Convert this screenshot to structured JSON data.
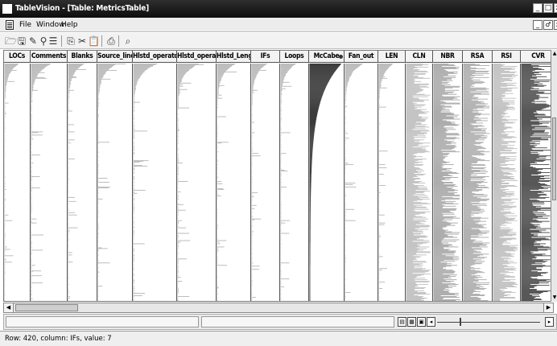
{
  "window": {
    "title": "TableVision - [Table: MetricsTable]",
    "controls": [
      "_",
      "□",
      "x"
    ]
  },
  "menu": {
    "items": [
      "File",
      "Window",
      "Help"
    ],
    "child_controls": [
      "_",
      "♂",
      "x"
    ]
  },
  "toolbar": {
    "buttons": [
      "open-icon",
      "save-icon",
      "edit-icon",
      "find-icon",
      "list-icon",
      "copy-icon",
      "cut-icon",
      "paste-icon",
      "print-icon",
      "zoom-icon"
    ]
  },
  "table": {
    "columns": [
      {
        "label": "LOCs",
        "render": "sparse",
        "color": "#b5b5b5",
        "seed": 1
      },
      {
        "label": "Comments",
        "render": "sparse",
        "color": "#b5b5b5",
        "seed": 2
      },
      {
        "label": "Blanks",
        "render": "sparse",
        "color": "#b5b5b5",
        "seed": 3
      },
      {
        "label": "Source_lines",
        "render": "sparse",
        "color": "#b5b5b5",
        "seed": 4
      },
      {
        "label": "Hlstd_operators",
        "render": "sparse",
        "color": "#b5b5b5",
        "seed": 5
      },
      {
        "label": "Hlstd_operands",
        "render": "sparse",
        "color": "#b5b5b5",
        "seed": 6
      },
      {
        "label": "Hlstd_Length",
        "render": "sparse",
        "color": "#b5b5b5",
        "seed": 7
      },
      {
        "label": "IFs",
        "render": "sparse",
        "color": "#b5b5b5",
        "seed": 8
      },
      {
        "label": "Loops",
        "render": "sparse",
        "color": "#b5b5b5",
        "seed": 9
      },
      {
        "label": "McCabe",
        "render": "sorted",
        "color": "#262626",
        "seed": 10,
        "sorted": true
      },
      {
        "label": "Fan_out",
        "render": "sparse",
        "color": "#b5b5b5",
        "seed": 11
      },
      {
        "label": "LEN",
        "render": "sparse",
        "color": "#b5b5b5",
        "seed": 12
      },
      {
        "label": "CLN",
        "render": "bars",
        "color": "#bdbdbd",
        "seed": 13
      },
      {
        "label": "NBR",
        "render": "bars",
        "color": "#a4a4a4",
        "seed": 14
      },
      {
        "label": "RSA",
        "render": "bars",
        "color": "#a9a9a9",
        "seed": 15
      },
      {
        "label": "RSI",
        "render": "bars",
        "color": "#bcbcbc",
        "seed": 16
      },
      {
        "label": "CVR",
        "render": "bars",
        "color": "#444444",
        "seed": 17
      }
    ]
  },
  "status": {
    "text": "Row: 420, column: IFs, value: 7"
  }
}
